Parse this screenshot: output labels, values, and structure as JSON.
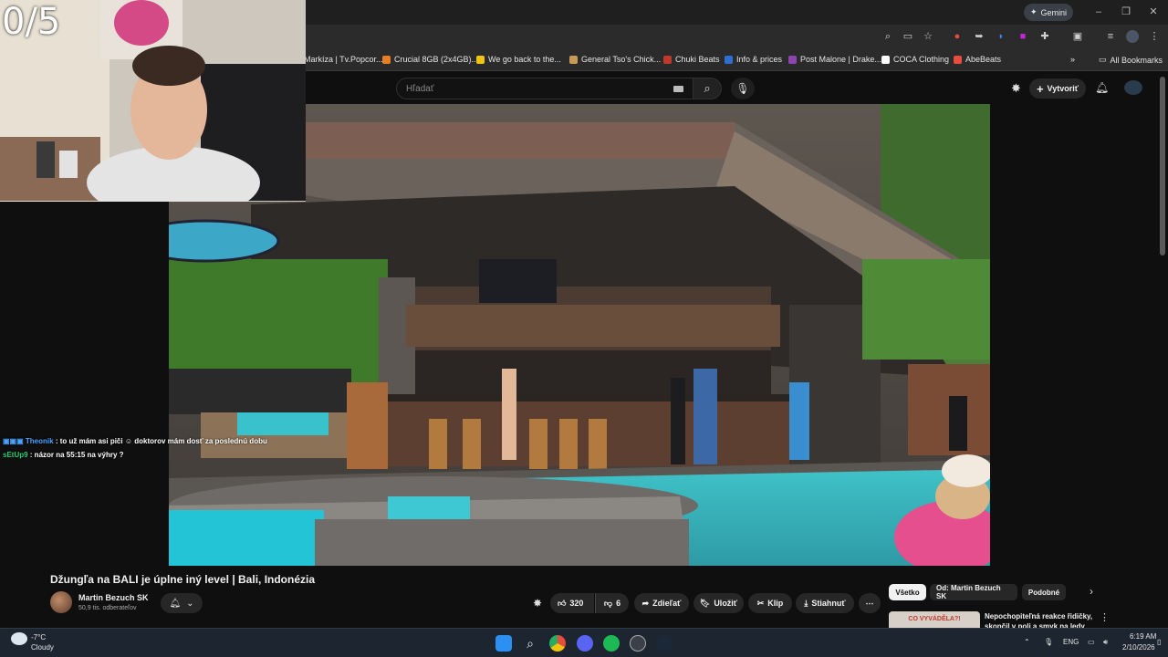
{
  "overlay": {
    "counter": "0/5",
    "chat": [
      {
        "user": "Theonik",
        "message": ": to už mám asi piči",
        "message2": "doktorov mám dosť za poslednú dobu",
        "color": "#4aa3ff"
      },
      {
        "user": "sEtUp9",
        "message": ": názor na 55:15 na výhry ?",
        "color": "#27d07a"
      }
    ]
  },
  "browser": {
    "gemini_label": "Gemini",
    "bookmarks": [
      {
        "label": "Markíza | Tv.Popcor...",
        "color": "#9b59b6"
      },
      {
        "label": "Crucial 8GB (2x4GB)...",
        "color": "#e67e22"
      },
      {
        "label": "We go back to the...",
        "color": "#f1c40f"
      },
      {
        "label": "General Tso's Chick...",
        "color": "#c79a57"
      },
      {
        "label": "Chuki Beats",
        "color": "#c0392b"
      },
      {
        "label": "Info & prices",
        "color": "#2c6fd1"
      },
      {
        "label": "Post Malone | Drake...",
        "color": "#8e44ad"
      },
      {
        "label": "COCA Clothing",
        "color": "#ffffff"
      },
      {
        "label": "AbeBeats",
        "color": "#e74c3c"
      }
    ],
    "all_bookmarks": "All Bookmarks"
  },
  "youtube": {
    "search_placeholder": "Hľadať",
    "create_label": "Vytvoriť",
    "video_title": "Džungľa na BALI je úplne iný level | Bali, Indonézia",
    "channel_name": "Martin Bezuch SK",
    "subscribers": "50,9 tis. odberateľov",
    "likes": "320",
    "dislikes": "6",
    "share_label": "Zdieľať",
    "save_label": "Uložiť",
    "clip_label": "Klip",
    "download_label": "Stiahnuť",
    "chips": [
      "Všetko",
      "Od: Martin Bezuch SK",
      "Podobné"
    ],
    "recommended": {
      "thumb_text": "CO VYVÁDĚLA?!",
      "title": "Nepochopiteľná reakce řidičky, skončil v poli a smyk na ledy"
    }
  },
  "taskbar": {
    "weather_temp": "-7°C",
    "weather_desc": "Cloudy",
    "language": "ENG",
    "time": "6:19 AM",
    "date": "2/10/2026"
  }
}
